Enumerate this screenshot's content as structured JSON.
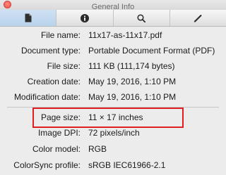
{
  "window": {
    "title": "General Info"
  },
  "toolbar": {
    "tabs": [
      {
        "icon": "document-icon",
        "active": true
      },
      {
        "icon": "info-icon",
        "active": false
      },
      {
        "icon": "search-icon",
        "active": false
      },
      {
        "icon": "pen-icon",
        "active": false
      }
    ]
  },
  "info": {
    "file_name": {
      "label": "File name:",
      "value": "11x17-as-11x17.pdf"
    },
    "document_type": {
      "label": "Document type:",
      "value": "Portable Document Format (PDF)"
    },
    "file_size": {
      "label": "File size:",
      "value": "111 KB (111,174 bytes)"
    },
    "creation_date": {
      "label": "Creation date:",
      "value": "May 19, 2016, 1:10 PM"
    },
    "modification_date": {
      "label": "Modification date:",
      "value": "May 19, 2016, 1:10 PM"
    },
    "page_size": {
      "label": "Page size:",
      "value": "11 × 17 inches"
    },
    "image_dpi": {
      "label": "Image DPI:",
      "value": "72 pixels/inch"
    },
    "color_model": {
      "label": "Color model:",
      "value": "RGB"
    },
    "colorsync_profile": {
      "label": "ColorSync profile:",
      "value": "sRGB IEC61966-2.1"
    }
  },
  "colors": {
    "highlight": "#e02020",
    "active_tab": "#b9d3ec"
  }
}
